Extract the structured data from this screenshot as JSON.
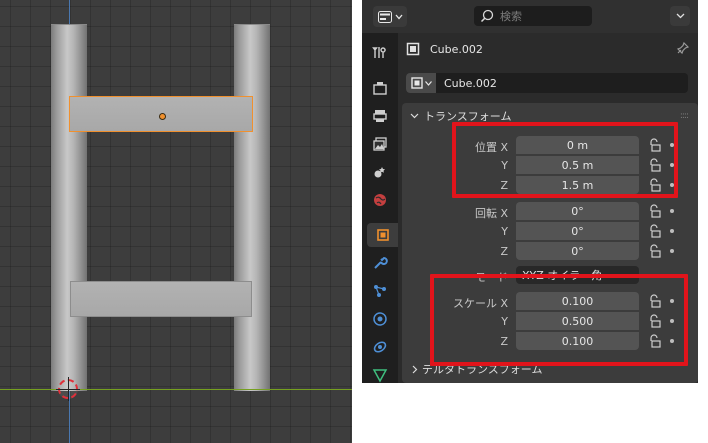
{
  "viewport": {
    "axis_colors": {
      "z": "#4a78b0",
      "x": "#76a020"
    },
    "selection_color": "#f0902e"
  },
  "header": {
    "search_placeholder": "検索",
    "editor_icon": "properties-editor-icon"
  },
  "tabs": [
    {
      "name": "tool-tab",
      "icon": "tool-icon"
    },
    {
      "name": "render-tab",
      "icon": "render-icon"
    },
    {
      "name": "output-tab",
      "icon": "output-icon"
    },
    {
      "name": "view-layer-tab",
      "icon": "view-layer-icon"
    },
    {
      "name": "scene-tab",
      "icon": "scene-icon"
    },
    {
      "name": "world-tab",
      "icon": "world-icon"
    },
    {
      "name": "object-tab",
      "icon": "object-icon",
      "active": true
    },
    {
      "name": "modifiers-tab",
      "icon": "wrench-icon"
    },
    {
      "name": "particles-tab",
      "icon": "particles-icon"
    },
    {
      "name": "physics-tab",
      "icon": "physics-icon"
    },
    {
      "name": "constraints-tab",
      "icon": "constraints-icon"
    },
    {
      "name": "data-tab",
      "icon": "mesh-data-icon"
    }
  ],
  "object": {
    "name": "Cube.002",
    "field_value": "Cube.002"
  },
  "transform": {
    "title": "トランスフォーム",
    "location_label": "位置",
    "rotation_label": "回転",
    "scale_label": "スケール",
    "axes": [
      "X",
      "Y",
      "Z"
    ],
    "location": [
      "0 m",
      "0.5 m",
      "1.5 m"
    ],
    "rotation": [
      "0°",
      "0°",
      "0°"
    ],
    "scale": [
      "0.100",
      "0.500",
      "0.100"
    ],
    "mode_label": "モード",
    "mode_value": "XYZ オイラー角"
  },
  "delta": {
    "title": "デルタトランスフォーム"
  },
  "annotations": {
    "highlight_color": "#e1141b"
  }
}
